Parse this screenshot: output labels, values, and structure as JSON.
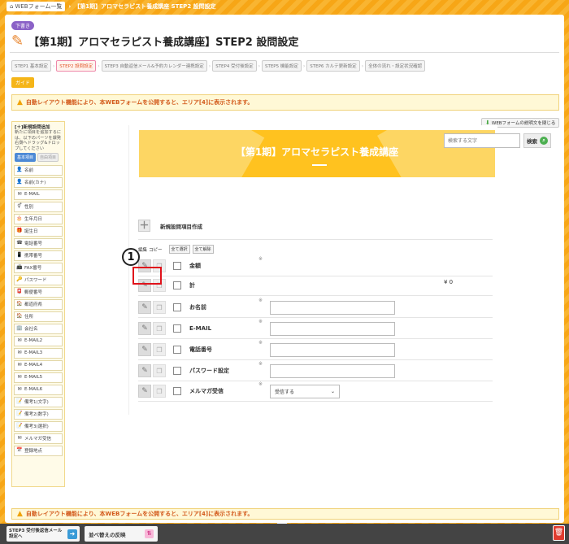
{
  "breadcrumb": {
    "home": "WEBフォーム一覧",
    "current": "【第1期】アロマセラピスト養成講座 STEP2 設問設定"
  },
  "header": {
    "badge": "下書き",
    "title": "【第1期】アロマセラピスト養成講座】STEP2 設問設定"
  },
  "steps": [
    "STEP1 基本設定",
    "STEP2 設問設定",
    "STEP3 自動返信メール&予約カレンダー連携設定",
    "STEP4 受付後設定",
    "STEP5 機能設定",
    "STEP6 カルテ更新設定",
    "全体の流れ・設定状況確認"
  ],
  "guide_label": "ガイド",
  "notice": "自動レイアウト機能により、本WEBフォームを公開すると、エリア[4]に表示されます。",
  "palette": {
    "title": "[＋]新規設問追加",
    "description": "新たに項目を追加するには、以下のパーツを爆発右側へドラッグ&ドロップしてください",
    "tabs": [
      "基本項目",
      "自由項目"
    ],
    "items": [
      {
        "icon": "person",
        "label": "名前"
      },
      {
        "icon": "person-kana",
        "label": "名前(カナ)"
      },
      {
        "icon": "mail",
        "label": "E-MAIL"
      },
      {
        "icon": "gender",
        "label": "性別"
      },
      {
        "icon": "cake",
        "label": "生年月日"
      },
      {
        "icon": "gift",
        "label": "誕生日"
      },
      {
        "icon": "phone",
        "label": "電話番号"
      },
      {
        "icon": "mobile",
        "label": "携帯番号"
      },
      {
        "icon": "fax",
        "label": "FAX番号"
      },
      {
        "icon": "key",
        "label": "パスワード"
      },
      {
        "icon": "postbox",
        "label": "郵便番号"
      },
      {
        "icon": "house",
        "label": "都道府県"
      },
      {
        "icon": "house",
        "label": "住所"
      },
      {
        "icon": "company",
        "label": "会社名"
      },
      {
        "icon": "mail",
        "label": "E-MAIL2"
      },
      {
        "icon": "mail",
        "label": "E-MAIL3"
      },
      {
        "icon": "mail",
        "label": "E-MAIL4"
      },
      {
        "icon": "mail",
        "label": "E-MAIL5"
      },
      {
        "icon": "mail",
        "label": "E-MAIL6"
      },
      {
        "icon": "note",
        "label": "備考1(文字)"
      },
      {
        "icon": "note",
        "label": "備考2(数字)"
      },
      {
        "icon": "note",
        "label": "備考3(選択)"
      },
      {
        "icon": "mail",
        "label": "メルマガ受信"
      },
      {
        "icon": "calendar",
        "label": "登録地点"
      }
    ]
  },
  "form_explain_close": "WEBフォームの説明文を閉じる",
  "banner_title": "【第1期】アロマセラピスト養成講座",
  "search": {
    "placeholder": "検索する文字",
    "button": "検索"
  },
  "new_item_label": "新規設問項目作成",
  "table_header": {
    "edit": "編集",
    "copy": "コピー",
    "select_all": "全て選択",
    "deselect_all": "全て解除"
  },
  "form_rows": [
    {
      "label": "金額",
      "type": "none",
      "required_mark": "※"
    },
    {
      "label": "計",
      "type": "amount",
      "value": "¥ 0"
    },
    {
      "label": "お名前",
      "type": "input",
      "required_mark": "※"
    },
    {
      "label": "E-MAIL",
      "type": "input",
      "required_mark": "※"
    },
    {
      "label": "電話番号",
      "type": "input",
      "required_mark": "※"
    },
    {
      "label": "パスワード設定",
      "type": "input",
      "required_mark": "※"
    },
    {
      "label": "メルマガ受信",
      "type": "select",
      "required_mark": "※",
      "value": "受信する"
    }
  ],
  "callout_number": "1",
  "bottom": {
    "step_button": "STEP3 受付後返信メール設定へ",
    "sort_button": "並べ替えの反映"
  },
  "colors": {
    "accent": "#f7a616",
    "warning_text": "#d35a1c",
    "callout_red": "#e0121b"
  }
}
